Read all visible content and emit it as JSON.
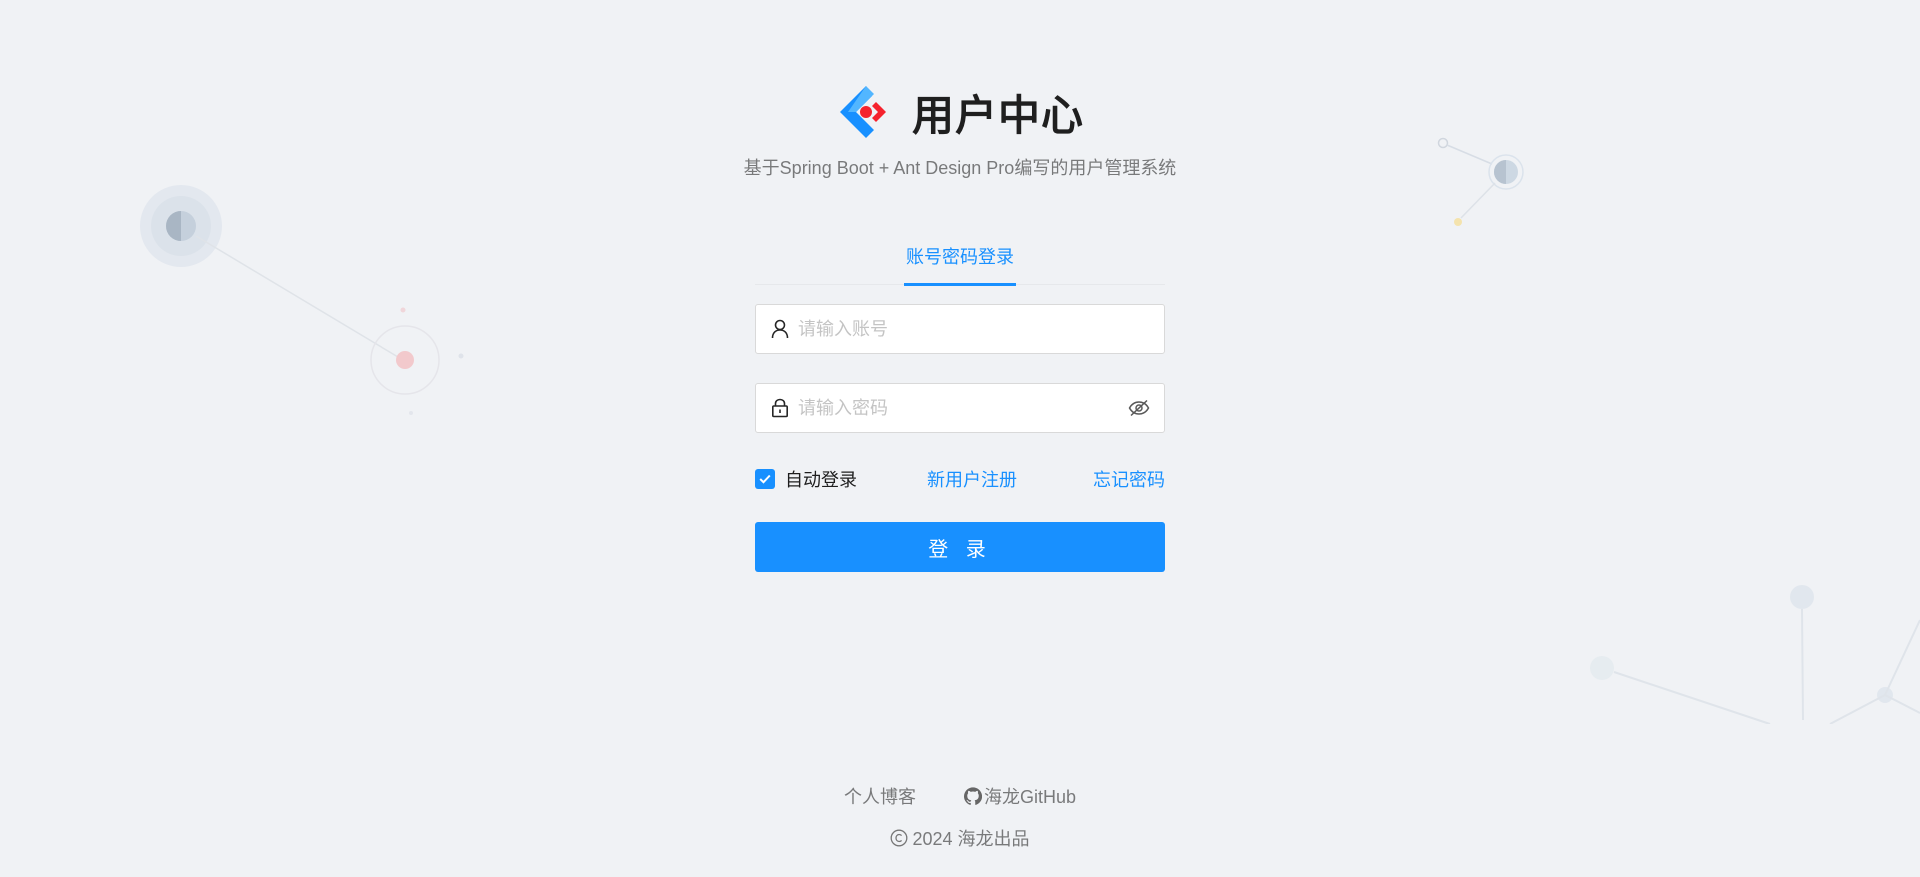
{
  "header": {
    "title": "用户中心",
    "subtitle": "基于Spring Boot + Ant Design Pro编写的用户管理系统",
    "logo_icon": "ant-design-logo"
  },
  "tabs": [
    {
      "label": "账号密码登录",
      "active": true
    }
  ],
  "form": {
    "username": {
      "value": "",
      "placeholder": "请输入账号",
      "icon": "user-icon"
    },
    "password": {
      "value": "",
      "placeholder": "请输入密码",
      "icon": "lock-icon",
      "toggle_icon": "eye-invisible-icon"
    },
    "remember": {
      "label": "自动登录",
      "checked": true
    },
    "register_link": "新用户注册",
    "forgot_link": "忘记密码",
    "submit_label": "登 录"
  },
  "footer": {
    "links": [
      {
        "label": "个人博客"
      },
      {
        "label": "海龙GitHub",
        "icon": "github-icon"
      }
    ],
    "copyright": "2024 海龙出品"
  },
  "colors": {
    "primary": "#1890ff",
    "background": "#f0f2f5"
  }
}
